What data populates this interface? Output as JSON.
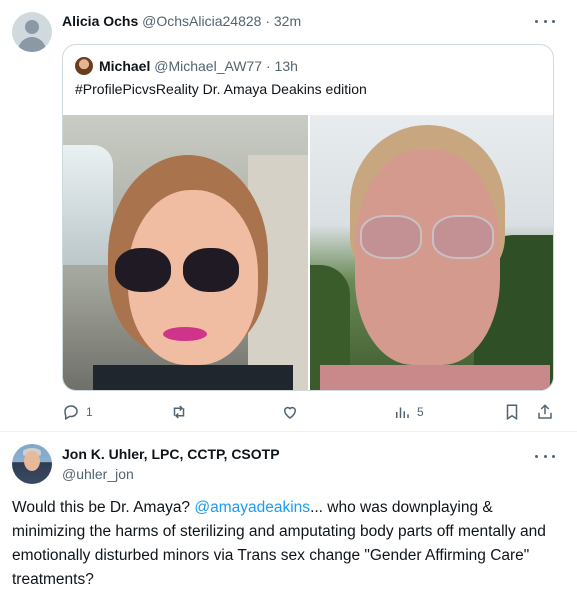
{
  "tweet1": {
    "author_name": "Alicia Ochs",
    "author_handle": "@OchsAlicia24828",
    "separator": " · ",
    "time": "32m",
    "quote": {
      "author_name": "Michael",
      "author_handle": "@Michael_AW77",
      "separator": " · ",
      "time": "13h",
      "text": "#ProfilePicvsReality Dr. Amaya Deakins edition"
    },
    "actions": {
      "reply_count": "1",
      "retweet_count": "",
      "like_count": "",
      "views_count": "5"
    }
  },
  "tweet2": {
    "author_name": "Jon K. Uhler, LPC, CCTP, CSOTP",
    "author_handle": "@uhler_jon",
    "text_before": "Would this be Dr. Amaya? ",
    "mention": "@amayadeakins",
    "text_after": "... who was downplaying & minimizing the harms of sterilizing and amputating body parts off mentally and emotionally disturbed minors via Trans sex change \"Gender Affirming Care\" treatments?"
  },
  "colors": {
    "text_primary": "#0f1419",
    "text_secondary": "#536471",
    "link": "#1d9bf0",
    "border": "#cfd9de"
  },
  "icons": {
    "reply": "reply-icon",
    "retweet": "retweet-icon",
    "like": "heart-icon",
    "views": "views-icon",
    "bookmark": "bookmark-icon",
    "share": "share-icon",
    "more": "more-icon"
  }
}
